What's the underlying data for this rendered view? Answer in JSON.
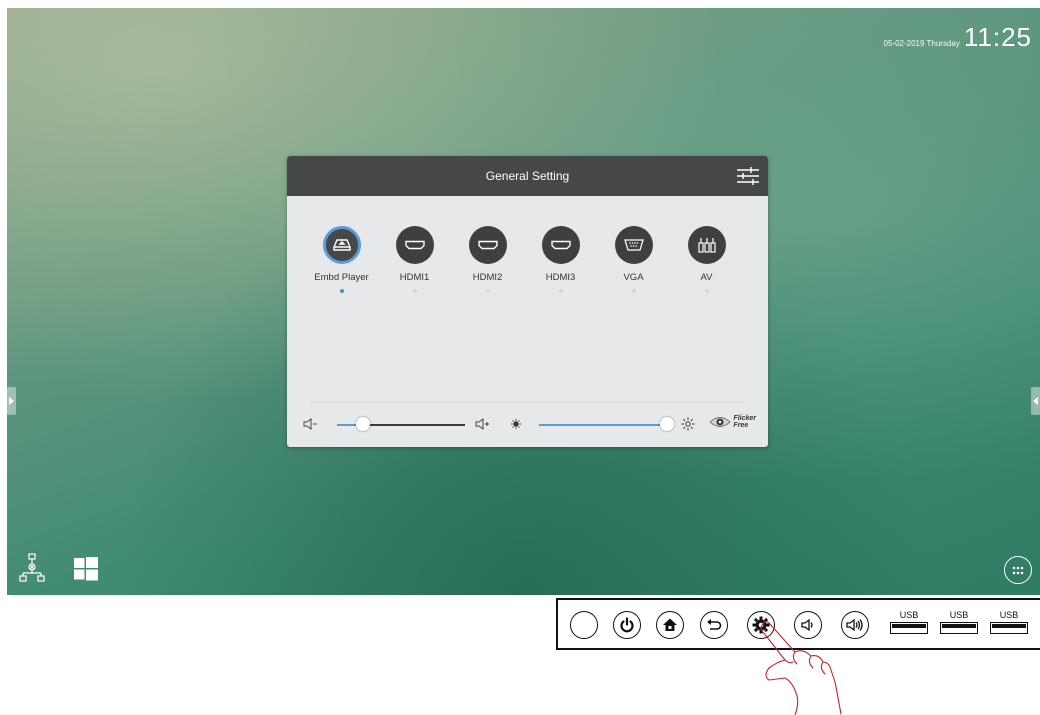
{
  "status": {
    "date": "05-02-2019 Thursday",
    "time": "11:25"
  },
  "panel": {
    "title": "General Setting",
    "sources": [
      {
        "label": "Embd Player",
        "icon": "media-player-icon",
        "active": true
      },
      {
        "label": "HDMI1",
        "icon": "hdmi-icon",
        "active": false
      },
      {
        "label": "HDMI2",
        "icon": "hdmi-icon",
        "active": false
      },
      {
        "label": "HDMI3",
        "icon": "hdmi-icon",
        "active": false
      },
      {
        "label": "VGA",
        "icon": "vga-icon",
        "active": false
      },
      {
        "label": "AV",
        "icon": "av-icon",
        "active": false
      }
    ],
    "volume": {
      "value_fraction": 0.2,
      "minus_label": "◁-",
      "plus_label": "◁+"
    },
    "brightness": {
      "value_fraction": 1.0
    },
    "flicker_free": {
      "line1": "Flicker",
      "line2": "Free"
    }
  },
  "hardware_buttons": {
    "labels": [
      "USB",
      "USB",
      "USB"
    ],
    "buttons": [
      "blank-button",
      "power-icon",
      "home-icon",
      "back-icon",
      "settings-icon",
      "volume-down-icon",
      "volume-up-icon"
    ]
  },
  "colors": {
    "accent": "#5b9bd8",
    "panel_header": "#464747",
    "panel_body": "#e7e8ea",
    "chalkboard": "#3f8a72"
  }
}
